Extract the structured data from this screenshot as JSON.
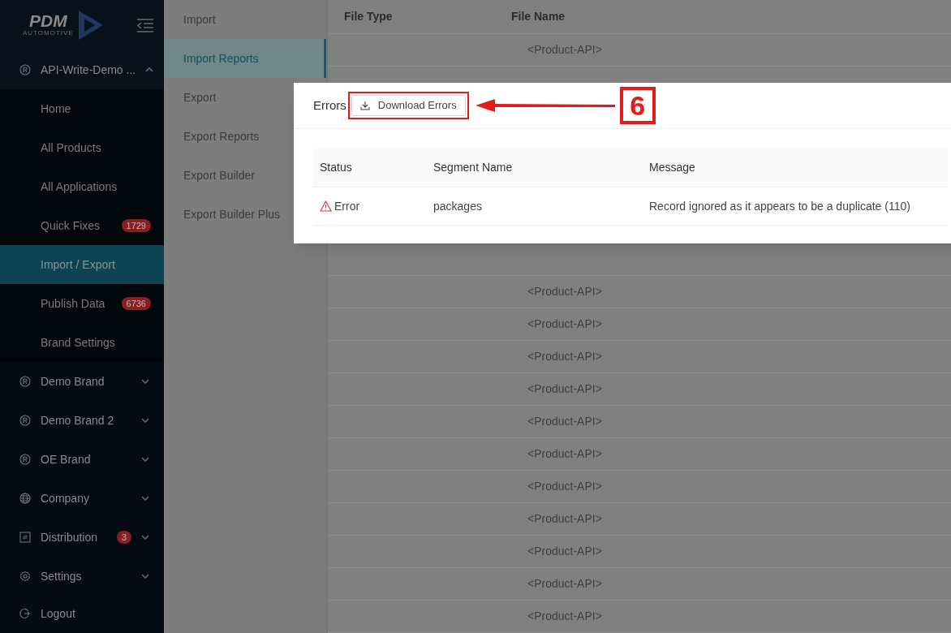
{
  "sidebar": {
    "logo": {
      "word": "PDM",
      "tagline": "AUTOMOTIVE"
    },
    "items": [
      {
        "label": "API-Write-Demo ...",
        "expanded": true,
        "children": [
          {
            "label": "Home",
            "selected": false
          },
          {
            "label": "All Products",
            "selected": false
          },
          {
            "label": "All Applications",
            "selected": false
          },
          {
            "label": "Quick Fixes",
            "badge": "1729",
            "selected": false
          },
          {
            "label": "Import / Export",
            "selected": true
          },
          {
            "label": "Publish Data",
            "badge": "6736",
            "selected": false
          },
          {
            "label": "Brand Settings",
            "selected": false
          }
        ]
      },
      {
        "label": "Demo Brand",
        "expanded": false
      },
      {
        "label": "Demo Brand 2",
        "expanded": false
      },
      {
        "label": "OE Brand",
        "expanded": false
      },
      {
        "label": "Company",
        "expanded": false
      },
      {
        "label": "Distribution",
        "badge": "3",
        "expanded": false
      },
      {
        "label": "Settings",
        "expanded": false
      },
      {
        "label": "Logout"
      }
    ]
  },
  "submenu": [
    {
      "label": "Import",
      "selected": false
    },
    {
      "label": "Import Reports",
      "selected": true
    },
    {
      "label": "Export",
      "selected": false
    },
    {
      "label": "Export Reports",
      "selected": false
    },
    {
      "label": "Export Builder",
      "selected": false
    },
    {
      "label": "Export Builder Plus",
      "selected": false
    }
  ],
  "table": {
    "columns": [
      "File Type",
      "File Name"
    ],
    "rows_top": [
      "<Product-API>"
    ],
    "rows_bottom": [
      "<Product-API>",
      "<Product-API>",
      "<Product-API>",
      "<Product-API>",
      "<Product-API>",
      "<Product-API>",
      "<Product-API>",
      "<Product-API>",
      "<Product-API>",
      "<Product-API>",
      "<Product-API>"
    ]
  },
  "dialog": {
    "title": "Errors",
    "button": "Download Errors",
    "columns": [
      "Status",
      "Segment Name",
      "Message"
    ],
    "rows": [
      {
        "status": "Error",
        "segment": "packages",
        "message": "Record ignored as it appears to be a duplicate (110)"
      }
    ]
  },
  "callout": {
    "number": "6"
  }
}
